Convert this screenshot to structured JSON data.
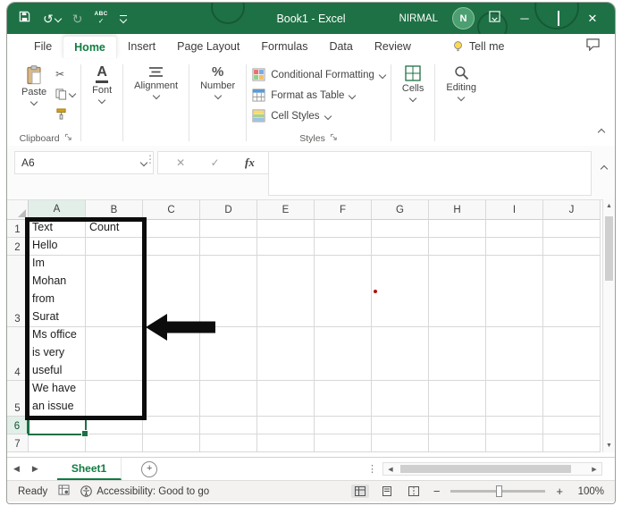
{
  "colors": {
    "titlebar_green": "#1E7145",
    "accent_green": "#107C41",
    "annotation_black": "#0c0c0c"
  },
  "titlebar": {
    "title": "Book1 - Excel",
    "user_name": "NIRMAL",
    "avatar_initial": "N",
    "spell_label": "ABC"
  },
  "tabs": {
    "file": "File",
    "home": "Home",
    "insert": "Insert",
    "page_layout": "Page Layout",
    "formulas": "Formulas",
    "data": "Data",
    "review": "Review",
    "tell_me": "Tell me"
  },
  "ribbon": {
    "paste_label": "Paste",
    "clipboard_group_label": "Clipboard",
    "font_label": "Font",
    "alignment_label": "Alignment",
    "number_label": "Number",
    "conditional_formatting_label": "Conditional Formatting",
    "format_as_table_label": "Format as Table",
    "cell_styles_label": "Cell Styles",
    "styles_group_label": "Styles",
    "cells_label": "Cells",
    "editing_label": "Editing"
  },
  "formula_bar": {
    "name_box_value": "A6",
    "fx_label": "fx",
    "formula_value": ""
  },
  "grid": {
    "columns": [
      "A",
      "B",
      "C",
      "D",
      "E",
      "F",
      "G",
      "H",
      "I",
      "J"
    ],
    "rows": [
      {
        "num": "1",
        "a": "Text",
        "b": "Count"
      },
      {
        "num": "2",
        "a": "Hello",
        "b": ""
      },
      {
        "num": "3",
        "a": "Im\nMohan\nfrom\nSurat",
        "b": ""
      },
      {
        "num": "4",
        "a": "Ms office\nis very\nuseful",
        "b": ""
      },
      {
        "num": "5",
        "a": "We have\nan issue",
        "b": ""
      },
      {
        "num": "6",
        "a": "",
        "b": ""
      },
      {
        "num": "7",
        "a": "",
        "b": ""
      }
    ],
    "selected_cell": "A6"
  },
  "sheet_bar": {
    "active_tab": "Sheet1"
  },
  "status_bar": {
    "mode": "Ready",
    "accessibility": "Accessibility: Good to go",
    "zoom": "100%"
  }
}
